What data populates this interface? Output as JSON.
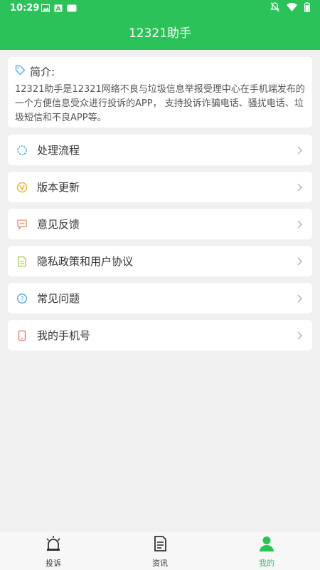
{
  "status_bar": {
    "time": "10:29",
    "left_icons": [
      "image-icon",
      "a-icon",
      "app-icon"
    ],
    "right_icons": [
      "mute-icon",
      "wifi-icon",
      "battery-icon"
    ]
  },
  "app_bar": {
    "title": "12321助手"
  },
  "intro": {
    "title": "简介:",
    "body": "12321助手是12321网络不良与垃圾信息举报受理中心在手机端发布的一个方便信息受众进行投诉的APP， 支持投诉诈骗电话、骚扰电话、垃圾短信和不良APP等。"
  },
  "menu": [
    {
      "label": "处理流程",
      "icon": "process-icon"
    },
    {
      "label": "版本更新",
      "icon": "version-update-icon"
    },
    {
      "label": "意见反馈",
      "icon": "feedback-icon"
    },
    {
      "label": "隐私政策和用户协议",
      "icon": "document-icon"
    },
    {
      "label": "常见问题",
      "icon": "question-icon"
    },
    {
      "label": "我的手机号",
      "icon": "phone-icon"
    }
  ],
  "bottom_nav": [
    {
      "label": "投诉",
      "icon": "alarm-icon",
      "active": false
    },
    {
      "label": "资讯",
      "icon": "news-icon",
      "active": false
    },
    {
      "label": "我的",
      "icon": "user-icon",
      "active": true
    }
  ],
  "colors": {
    "primary": "#2cc25a",
    "background": "#f0f0f0",
    "card": "#ffffff"
  }
}
